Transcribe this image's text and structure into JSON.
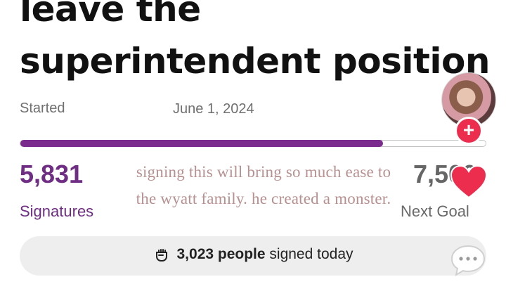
{
  "title": {
    "line1": "leave the",
    "line2": "superintendent position"
  },
  "meta": {
    "started_label": "Started",
    "started_date": "June 1, 2024"
  },
  "progress": {
    "signatures": 5831,
    "goal": 7500,
    "fraction": 0.78
  },
  "stats": {
    "signatures_count": "5,831",
    "signatures_label": "Signatures",
    "goal_count": "7,500",
    "goal_label": "Next Goal"
  },
  "overlay_caption": "signing this will bring so much ease to the wyatt family. he created a monster.",
  "today": {
    "count": "3,023 people",
    "suffix": "signed today",
    "icon": "fist-icon"
  },
  "side_actions": {
    "follow_icon": "plus-icon",
    "like_icon": "heart-icon",
    "comment_icon": "comment-icon"
  },
  "colors": {
    "accent_purple": "#7b2a8d",
    "heart_red": "#ec2d4d",
    "overlay_text": "#b89090"
  }
}
